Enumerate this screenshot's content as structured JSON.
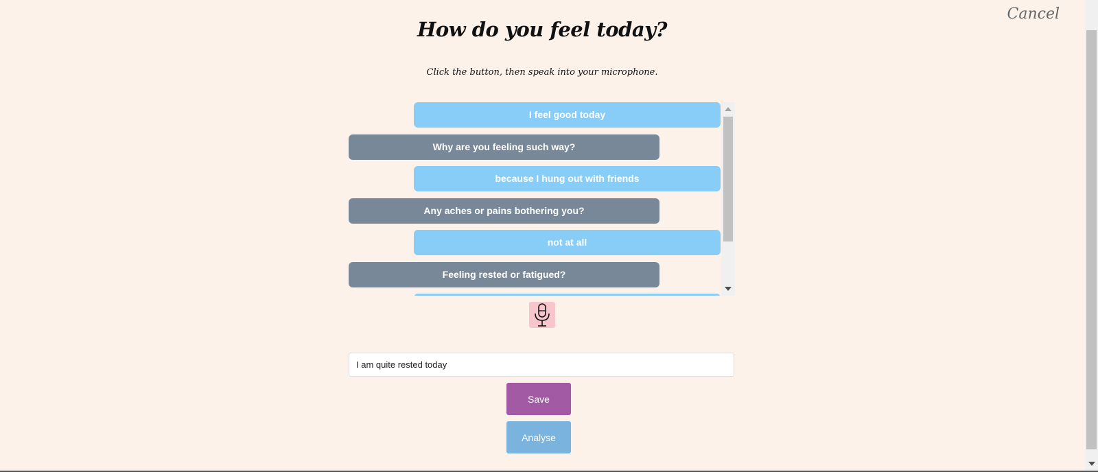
{
  "header": {
    "title": "How do you feel today?",
    "subtitle": "Click the button, then speak into your microphone.",
    "cancel_label": "Cancel"
  },
  "chat": {
    "messages": [
      {
        "role": "user",
        "text": "I feel good today"
      },
      {
        "role": "bot",
        "text": "Why are you feeling such way?"
      },
      {
        "role": "user",
        "text": "because I hung out with friends"
      },
      {
        "role": "bot",
        "text": "Any aches or pains bothering you?"
      },
      {
        "role": "user",
        "text": "not at all"
      },
      {
        "role": "bot",
        "text": "Feeling rested or fatigued?"
      },
      {
        "role": "user",
        "text": ""
      }
    ]
  },
  "mic": {
    "icon": "microphone-icon",
    "color": "#f7c6cd"
  },
  "input": {
    "value": "I am quite rested today"
  },
  "actions": {
    "save_label": "Save",
    "analyse_label": "Analyse"
  },
  "colors": {
    "background": "#fdf2ea",
    "user_bubble": "#87cdf7",
    "bot_bubble": "#788898",
    "save": "#a15aa3",
    "analyse": "#7ab4de"
  }
}
